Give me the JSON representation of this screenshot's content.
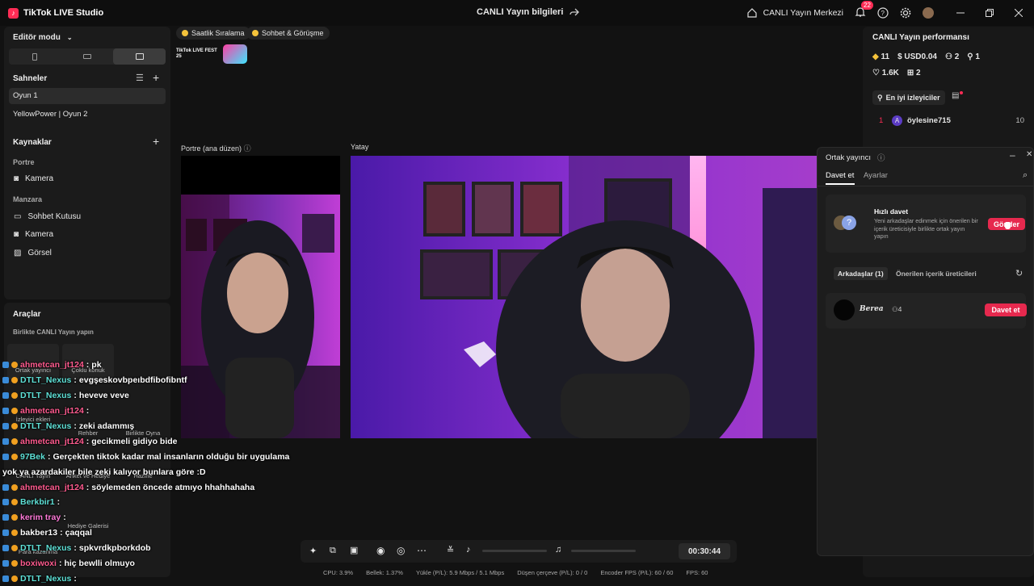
{
  "app": {
    "title": "TikTok LIVE Studio",
    "stream_info": "CANLI Yayın bilgileri",
    "live_center": "CANLI Yayın Merkezi",
    "notif_count": "22"
  },
  "left": {
    "mode": "Editör modu",
    "scenes_title": "Sahneler",
    "scenes": [
      "Oyun 1",
      "YellowPower | Oyun 2"
    ],
    "sources_title": "Kaynaklar",
    "portrait_label": "Portre",
    "portrait_sources": [
      "Kamera"
    ],
    "landscape_label": "Manzara",
    "landscape_sources": [
      "Sohbet Kutusu",
      "Kamera",
      "Görsel"
    ],
    "tools_title": "Araçlar",
    "tools_sub": "Birlikte CANLI Yayın yapın",
    "tools": [
      "Ortak yayıncı",
      "Çoklu konuk",
      "İzleyici ekleri",
      "Rehber",
      "Birlikte Oyna",
      "CANLI Yayın",
      "Anket ve Hediye",
      "Hazine",
      "Hediye Galerisi",
      "Para kazanma"
    ]
  },
  "main": {
    "chips": [
      "Saatlik Sıralama",
      "Sohbet & Görüşme"
    ],
    "fest_label": "TikTok LIVE FEST 25",
    "portrait_title": "Portre (ana düzen)",
    "landscape_title": "Yatay"
  },
  "chat": [
    {
      "user": "ahmetcan_jt124",
      "color": "#ff5b8f",
      "msg": "pk"
    },
    {
      "user": "DTLT_Nexus",
      "color": "#5ee0d6",
      "msg": "evgşeskovbpeıbdfibofibntf"
    },
    {
      "user": "DTLT_Nexus",
      "color": "#5ee0d6",
      "msg": "heveve veve"
    },
    {
      "user": "ahmetcan_jt124",
      "color": "#ff5b8f",
      "msg": ""
    },
    {
      "user": "DTLT_Nexus",
      "color": "#5ee0d6",
      "msg": "zeki adammış"
    },
    {
      "user": "ahmetcan_jt124",
      "color": "#ff5b8f",
      "msg": "gecikmeli gidiyo bide"
    },
    {
      "user": "97Bek",
      "color": "#5ee0d6",
      "msg": "Gerçekten tiktok kadar mal insanların olduğu bir uygulama"
    },
    {
      "user": "",
      "color": "#fff",
      "msg": "yok ya azardakiler bile zeki kalıyor bunlara göre :D"
    },
    {
      "user": "ahmetcan_jt124",
      "color": "#ff5b8f",
      "msg": "söylemeden öncede atmıyo hhahhahaha"
    },
    {
      "user": "Berkbir1",
      "color": "#5ee0d6",
      "msg": ""
    },
    {
      "user": "kerim tray",
      "color": "#ff7ad9",
      "msg": ""
    },
    {
      "user": "bakber13",
      "color": "#fff",
      "msg": "çaqqal"
    },
    {
      "user": "DTLT_Nexus",
      "color": "#5ee0d6",
      "msg": "spkvrdkpborkdob"
    },
    {
      "user": "boxiwoxi",
      "color": "#ff5b8f",
      "msg": "hiç bewlli olmuyo"
    },
    {
      "user": "DTLT_Nexus",
      "color": "#5ee0d6",
      "msg": ""
    }
  ],
  "right": {
    "perf_title": "CANLI Yayın performansı",
    "diamonds": "11",
    "usd": "USD0.04",
    "viewers": "2",
    "follows": "1",
    "likes": "1.6K",
    "gifts": "2",
    "top_viewers_btn": "En iyi izleyiciler",
    "top": [
      {
        "rank": "1",
        "avatar": "A",
        "name": "öylesine715",
        "score": "10"
      }
    ]
  },
  "cohost": {
    "title": "Ortak yayıncı",
    "tabs": [
      "Davet et",
      "Ayarlar"
    ],
    "quick_title": "Hızlı davet",
    "quick_desc": "Yeni arkadaşlar edinmek için önerilen bir içerik üreticisiyle birlikte ortak yayın yapın",
    "send_btn": "Gönder",
    "friends_tab": "Arkadaşlar (1)",
    "suggested_tab": "Önerilen içerik üreticileri",
    "friend_name": "Berea",
    "friend_count": "4",
    "invite_btn": "Davet et"
  },
  "timer": "00:30:44",
  "status": {
    "cpu": "CPU: 3.9%",
    "mem": "Bellek: 1.37%",
    "upload": "Yükle (P/L): 5.9 Mbps / 5.1 Mbps",
    "drop": "Düşen çerçeve (P/L): 0 / 0",
    "enc": "Encoder FPS (P/L): 60 / 60",
    "fps": "FPS: 60"
  }
}
